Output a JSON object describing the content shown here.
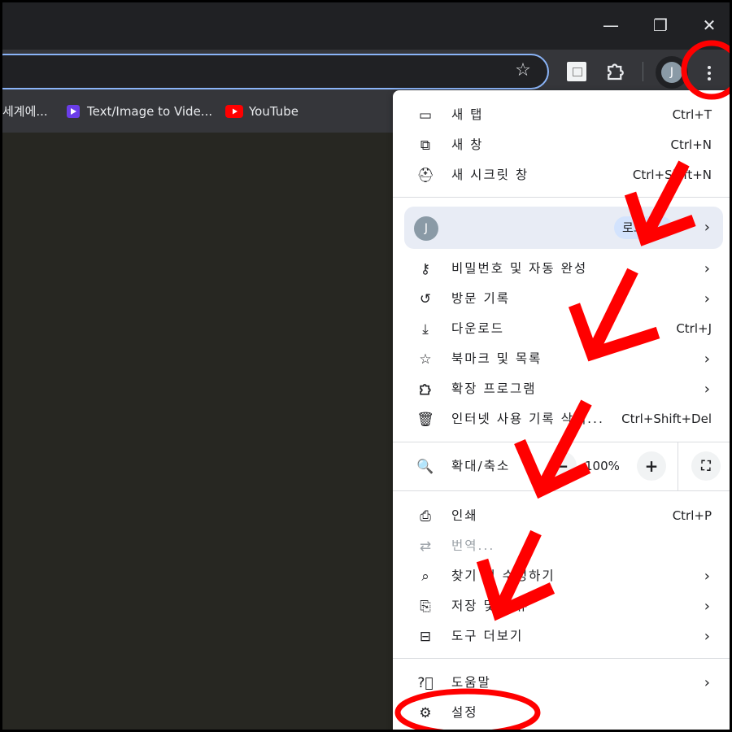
{
  "window": {
    "minimize_glyph": "—",
    "restore_glyph": "❐",
    "close_glyph": "✕"
  },
  "toolbar": {
    "profile_initial": "J",
    "icons": [
      "star-icon",
      "extension-tile-icon",
      "puzzle-icon",
      "kebab-menu-icon"
    ]
  },
  "bookmarks": [
    {
      "label": "세계에...",
      "icon": "none"
    },
    {
      "label": "Text/Image to Vide...",
      "icon": "video-app-icon"
    },
    {
      "label": "YouTube",
      "icon": "youtube-icon"
    }
  ],
  "menu": {
    "group1": [
      {
        "icon": "new-tab-icon",
        "label": "새 탭",
        "shortcut": "Ctrl+T"
      },
      {
        "icon": "new-window-icon",
        "label": "새 창",
        "shortcut": "Ctrl+N"
      },
      {
        "icon": "incognito-icon",
        "label": "새 시크릿 창",
        "shortcut": "Ctrl+Shift+N"
      }
    ],
    "profile": {
      "initial": "J",
      "pill_label": "로그인"
    },
    "group2": [
      {
        "icon": "key-icon",
        "label": "비밀번호 및 자동 완성",
        "has_submenu": true
      },
      {
        "icon": "history-icon",
        "label": "방문 기록",
        "has_submenu": true
      },
      {
        "icon": "download-icon",
        "label": "다운로드",
        "shortcut": "Ctrl+J"
      },
      {
        "icon": "bookmark-star-icon",
        "label": "북마크 및 목록",
        "has_submenu": true
      },
      {
        "icon": "extension-icon",
        "label": "확장 프로그램",
        "has_submenu": true
      },
      {
        "icon": "trash-icon",
        "label": "인터넷 사용 기록 삭제...",
        "shortcut": "Ctrl+Shift+Del"
      }
    ],
    "zoom": {
      "icon": "zoom-icon",
      "label": "확대/축소",
      "value": "100%",
      "minus": "−",
      "plus": "+",
      "fullscreen": "⛶"
    },
    "group3": [
      {
        "icon": "print-icon",
        "label": "인쇄",
        "shortcut": "Ctrl+P"
      },
      {
        "icon": "translate-icon",
        "label": "번역...",
        "disabled": true
      },
      {
        "icon": "find-icon",
        "label": "찾기 및 수정하기",
        "has_submenu": true
      },
      {
        "icon": "save-share-icon",
        "label": "저장 및 공유",
        "has_submenu": true
      },
      {
        "icon": "toolbox-icon",
        "label": "도구 더보기",
        "has_submenu": true
      }
    ],
    "group4": [
      {
        "icon": "help-icon",
        "label": "도움말",
        "has_submenu": true
      },
      {
        "icon": "settings-gear-icon",
        "label": "설정"
      }
    ],
    "chevron": "›"
  },
  "annotations": {
    "color": "#ff0000",
    "arrow_count": 4,
    "circled_targets": [
      "kebab-menu-button",
      "menu-item-settings"
    ]
  }
}
